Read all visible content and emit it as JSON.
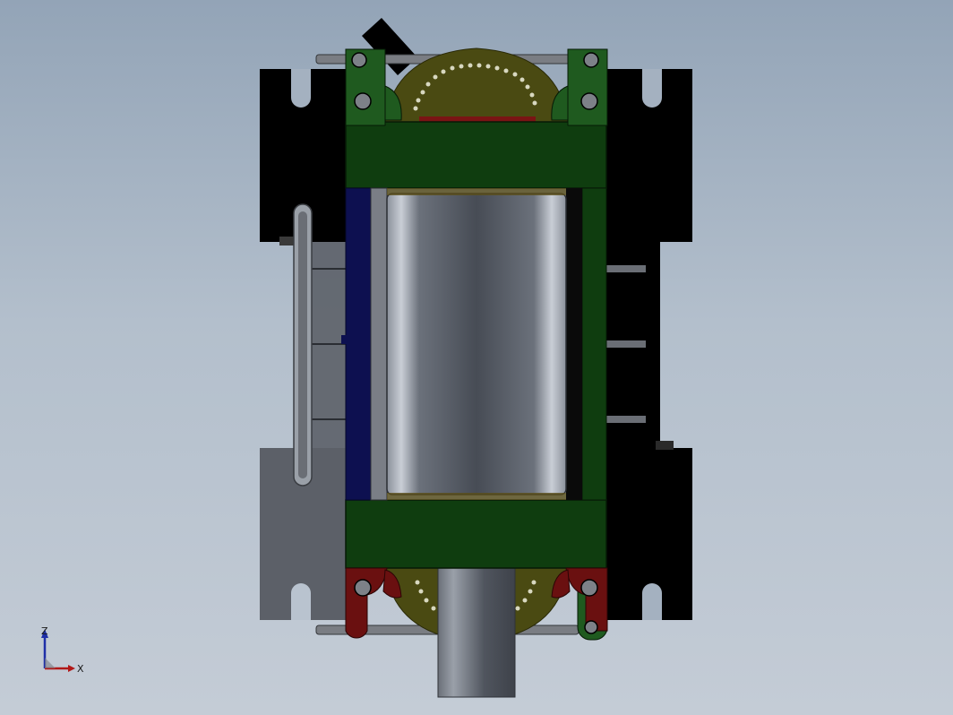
{
  "viewport": {
    "background_top": "#93a4b7",
    "background_bottom": "#c4ccd6"
  },
  "model": {
    "colors": {
      "frame_green": "#0f3d0f",
      "frame_green_light": "#1f5a1f",
      "clamp_red": "#6a1010",
      "disc_olive": "#4a4a12",
      "cylinder": "#4e5560",
      "rail_blue": "#0d1050",
      "block_black": "#000000",
      "block_grey": "#5c6068",
      "rod_grey": "#7a7d83"
    }
  },
  "triad": {
    "z_label": "Z",
    "x_label": "X",
    "z_color": "#1f2fa8",
    "x_color": "#b11818"
  }
}
